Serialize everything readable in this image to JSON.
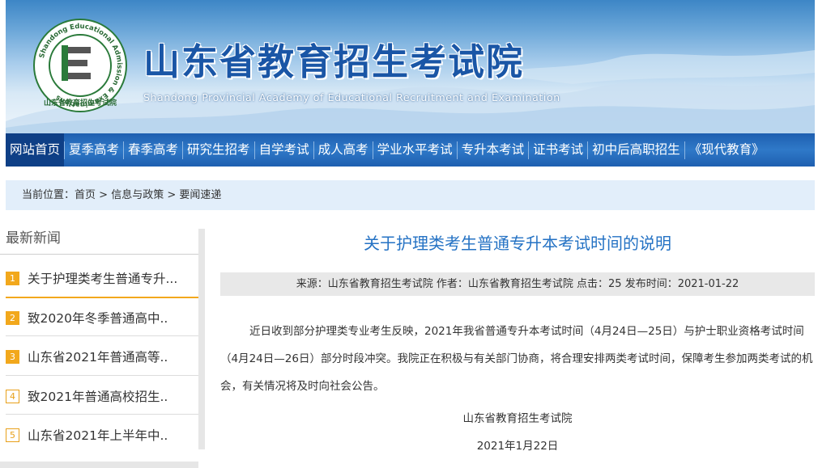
{
  "header": {
    "title_cn": "山东省教育招生考试院",
    "title_en": "Shandong Provincial Academy of Educational Recruitment and Examination",
    "logo_ring_text": "Shandong Educational Admission & Examinations",
    "logo_bottom_text": "山东省教育招生考试院",
    "logo_letter": "E"
  },
  "nav": {
    "items": [
      {
        "label": "网站首页",
        "active": true
      },
      {
        "label": "夏季高考"
      },
      {
        "label": "春季高考"
      },
      {
        "label": "研究生招考"
      },
      {
        "label": "自学考试"
      },
      {
        "label": "成人高考"
      },
      {
        "label": "学业水平考试"
      },
      {
        "label": "专升本考试"
      },
      {
        "label": "证书考试"
      },
      {
        "label": "初中后高职招生"
      },
      {
        "label": "《现代教育》"
      }
    ]
  },
  "breadcrumb": {
    "prefix": "当前位置：",
    "items": [
      "首页",
      "信息与政策",
      "要闻速递"
    ],
    "separator": " > "
  },
  "sidebar": {
    "title": "最新新闻",
    "items": [
      {
        "num": "1",
        "text": "关于护理类考生普通专升..."
      },
      {
        "num": "2",
        "text": "致2020年冬季普通高中.."
      },
      {
        "num": "3",
        "text": "山东省2021年普通高等.."
      },
      {
        "num": "4",
        "text": "致2021年普通高校招生.."
      },
      {
        "num": "5",
        "text": "山东省2021年上半年中.."
      }
    ]
  },
  "article": {
    "title": "关于护理类考生普通专升本考试时间的说明",
    "meta": "来源：山东省教育招生考试院 作者：山东省教育招生考试院 点击：25 发布时间：2021-01-22",
    "paragraph": "近日收到部分护理类专业考生反映，2021年我省普通专升本考试时间（4月24日—25日）与护士职业资格考试时间（4月24日—26日）部分时段冲突。我院正在积极与有关部门协商，将合理安排两类考试时间，保障考生参加两类考试的机会，有关情况将及时向社会公告。",
    "signature": "山东省教育招生考试院",
    "date": "2021年1月22日"
  },
  "colors": {
    "nav_bg": "#2f79c8",
    "nav_active": "#0e3f86",
    "title_blue": "#2472c4",
    "accent_orange": "#f2a81c",
    "breadcrumb_bg": "#e2eefa"
  }
}
